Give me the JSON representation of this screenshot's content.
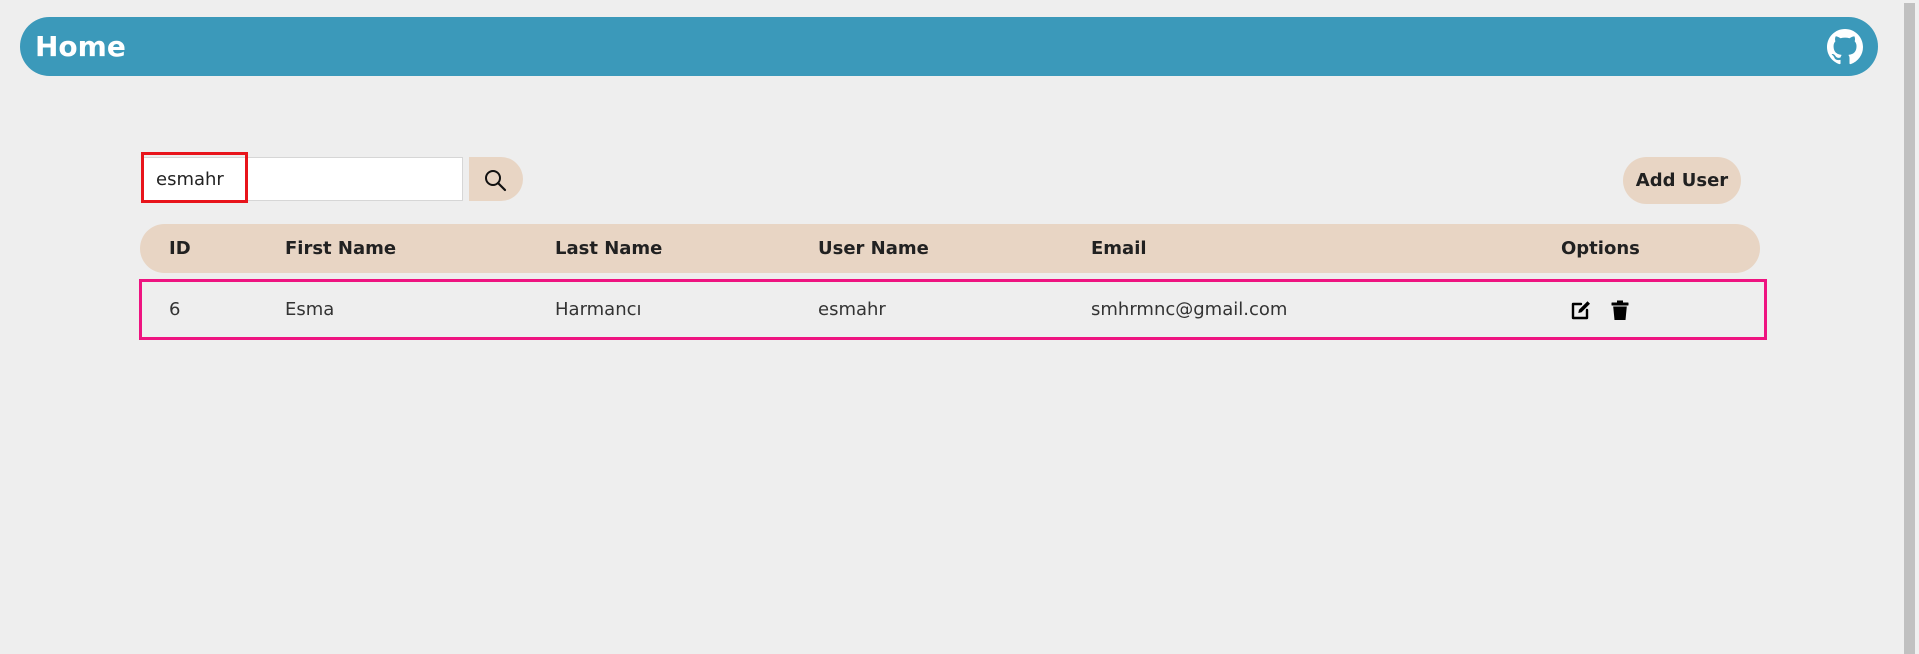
{
  "navbar": {
    "title": "Home",
    "github_icon": "github-icon"
  },
  "search": {
    "value": "esmahr",
    "placeholder": "",
    "button_icon": "search-icon"
  },
  "add_user_label": "Add User",
  "table": {
    "headers": [
      "ID",
      "First Name",
      "Last Name",
      "User Name",
      "Email",
      "Options"
    ],
    "rows": [
      {
        "id": "6",
        "first_name": "Esma",
        "last_name": "Harmancı",
        "user_name": "esmahr",
        "email": "smhrmnc@gmail.com",
        "options": [
          "edit-icon",
          "trash-icon"
        ]
      }
    ]
  },
  "colors": {
    "navbar": "#3b99ba",
    "accent_beige": "#e8d5c4",
    "search_highlight": "#e8141b",
    "row_highlight": "#ee1380"
  }
}
